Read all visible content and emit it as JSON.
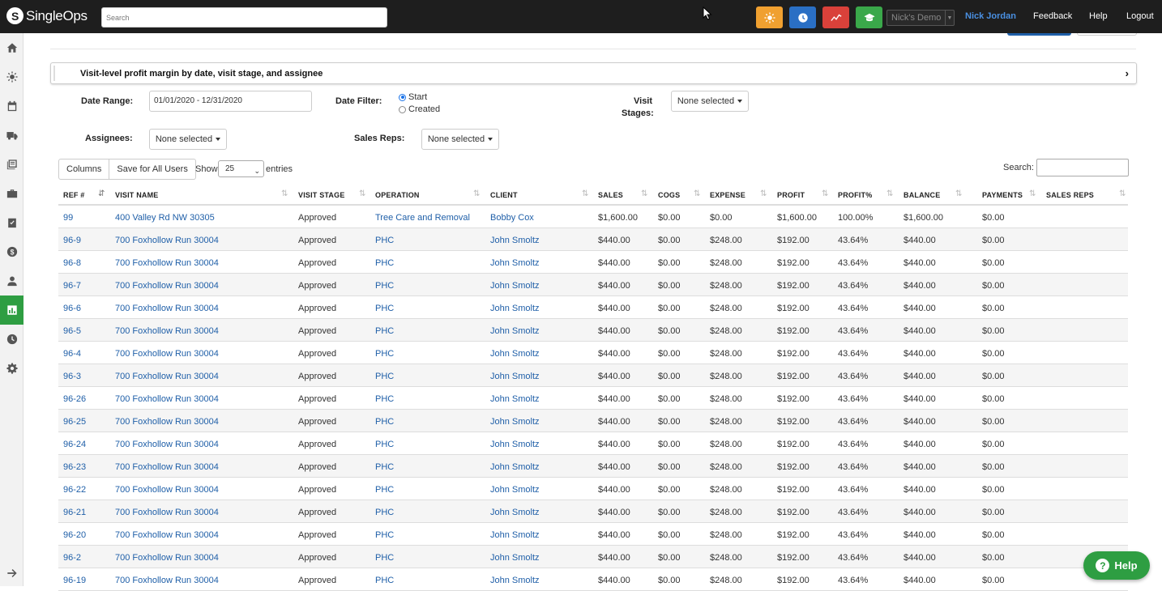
{
  "app": {
    "brand": "SingleOps",
    "search_placeholder": "Search",
    "account_select": "Nick's Demo",
    "user_name": "Nick Jordan",
    "links": {
      "feedback": "Feedback",
      "help": "Help",
      "logout": "Logout"
    },
    "quick_buttons": [
      {
        "name": "sun-icon",
        "color": "#f0a030"
      },
      {
        "name": "clock-icon",
        "color": "#2a6fc4"
      },
      {
        "name": "trend-icon",
        "color": "#d9413a"
      },
      {
        "name": "graduation-cap-icon",
        "color": "#3aa84a"
      }
    ]
  },
  "sidebar": {
    "items": [
      "home-icon",
      "sun-icon",
      "calendar-icon",
      "truck-icon",
      "list-icon",
      "briefcase-icon",
      "checklist-icon",
      "dollar-icon",
      "user-icon",
      "chart-icon",
      "clock-icon",
      "gear-icon"
    ],
    "active": "chart-icon",
    "expand": "arrow-right-icon"
  },
  "report": {
    "description": "Visit-level profit margin by date, visit stage, and assignee"
  },
  "filters": {
    "date_range_label": "Date Range:",
    "date_range_value": "01/01/2020 - 12/31/2020",
    "date_filter_label": "Date Filter:",
    "date_filter_options": [
      "Start",
      "Created"
    ],
    "date_filter_selected": "Start",
    "visit_stages_label_1": "Visit",
    "visit_stages_label_2": "Stages:",
    "visit_stages_value": "None selected",
    "assignees_label": "Assignees:",
    "assignees_value": "None selected",
    "sales_reps_label": "Sales Reps:",
    "sales_reps_value": "None selected"
  },
  "table_controls": {
    "columns_button": "Columns",
    "save_button": "Save for All Users",
    "show_label": "Show",
    "entries_value": "25",
    "entries_label": "entries",
    "search_label": "Search:"
  },
  "table": {
    "columns": [
      "REF #",
      "VISIT NAME",
      "VISIT STAGE",
      "OPERATION",
      "CLIENT",
      "SALES",
      "COGS",
      "EXPENSE",
      "PROFIT",
      "PROFIT%",
      "BALANCE",
      "PAYMENTS",
      "SALES REPS"
    ],
    "rows": [
      [
        "99",
        "400 Valley Rd NW 30305",
        "Approved",
        "Tree Care and Removal",
        "Bobby Cox",
        "$1,600.00",
        "$0.00",
        "$0.00",
        "$1,600.00",
        "100.00%",
        "$1,600.00",
        "$0.00",
        ""
      ],
      [
        "96-9",
        "700 Foxhollow Run 30004",
        "Approved",
        "PHC",
        "John Smoltz",
        "$440.00",
        "$0.00",
        "$248.00",
        "$192.00",
        "43.64%",
        "$440.00",
        "$0.00",
        ""
      ],
      [
        "96-8",
        "700 Foxhollow Run 30004",
        "Approved",
        "PHC",
        "John Smoltz",
        "$440.00",
        "$0.00",
        "$248.00",
        "$192.00",
        "43.64%",
        "$440.00",
        "$0.00",
        ""
      ],
      [
        "96-7",
        "700 Foxhollow Run 30004",
        "Approved",
        "PHC",
        "John Smoltz",
        "$440.00",
        "$0.00",
        "$248.00",
        "$192.00",
        "43.64%",
        "$440.00",
        "$0.00",
        ""
      ],
      [
        "96-6",
        "700 Foxhollow Run 30004",
        "Approved",
        "PHC",
        "John Smoltz",
        "$440.00",
        "$0.00",
        "$248.00",
        "$192.00",
        "43.64%",
        "$440.00",
        "$0.00",
        ""
      ],
      [
        "96-5",
        "700 Foxhollow Run 30004",
        "Approved",
        "PHC",
        "John Smoltz",
        "$440.00",
        "$0.00",
        "$248.00",
        "$192.00",
        "43.64%",
        "$440.00",
        "$0.00",
        ""
      ],
      [
        "96-4",
        "700 Foxhollow Run 30004",
        "Approved",
        "PHC",
        "John Smoltz",
        "$440.00",
        "$0.00",
        "$248.00",
        "$192.00",
        "43.64%",
        "$440.00",
        "$0.00",
        ""
      ],
      [
        "96-3",
        "700 Foxhollow Run 30004",
        "Approved",
        "PHC",
        "John Smoltz",
        "$440.00",
        "$0.00",
        "$248.00",
        "$192.00",
        "43.64%",
        "$440.00",
        "$0.00",
        ""
      ],
      [
        "96-26",
        "700 Foxhollow Run 30004",
        "Approved",
        "PHC",
        "John Smoltz",
        "$440.00",
        "$0.00",
        "$248.00",
        "$192.00",
        "43.64%",
        "$440.00",
        "$0.00",
        ""
      ],
      [
        "96-25",
        "700 Foxhollow Run 30004",
        "Approved",
        "PHC",
        "John Smoltz",
        "$440.00",
        "$0.00",
        "$248.00",
        "$192.00",
        "43.64%",
        "$440.00",
        "$0.00",
        ""
      ],
      [
        "96-24",
        "700 Foxhollow Run 30004",
        "Approved",
        "PHC",
        "John Smoltz",
        "$440.00",
        "$0.00",
        "$248.00",
        "$192.00",
        "43.64%",
        "$440.00",
        "$0.00",
        ""
      ],
      [
        "96-23",
        "700 Foxhollow Run 30004",
        "Approved",
        "PHC",
        "John Smoltz",
        "$440.00",
        "$0.00",
        "$248.00",
        "$192.00",
        "43.64%",
        "$440.00",
        "$0.00",
        ""
      ],
      [
        "96-22",
        "700 Foxhollow Run 30004",
        "Approved",
        "PHC",
        "John Smoltz",
        "$440.00",
        "$0.00",
        "$248.00",
        "$192.00",
        "43.64%",
        "$440.00",
        "$0.00",
        ""
      ],
      [
        "96-21",
        "700 Foxhollow Run 30004",
        "Approved",
        "PHC",
        "John Smoltz",
        "$440.00",
        "$0.00",
        "$248.00",
        "$192.00",
        "43.64%",
        "$440.00",
        "$0.00",
        ""
      ],
      [
        "96-20",
        "700 Foxhollow Run 30004",
        "Approved",
        "PHC",
        "John Smoltz",
        "$440.00",
        "$0.00",
        "$248.00",
        "$192.00",
        "43.64%",
        "$440.00",
        "$0.00",
        ""
      ],
      [
        "96-2",
        "700 Foxhollow Run 30004",
        "Approved",
        "PHC",
        "John Smoltz",
        "$440.00",
        "$0.00",
        "$248.00",
        "$192.00",
        "43.64%",
        "$440.00",
        "$0.00",
        ""
      ],
      [
        "96-19",
        "700 Foxhollow Run 30004",
        "Approved",
        "PHC",
        "John Smoltz",
        "$440.00",
        "$0.00",
        "$248.00",
        "$192.00",
        "43.64%",
        "$440.00",
        "$0.00",
        ""
      ]
    ]
  },
  "help_widget": {
    "label": "Help",
    "icon": "?"
  }
}
